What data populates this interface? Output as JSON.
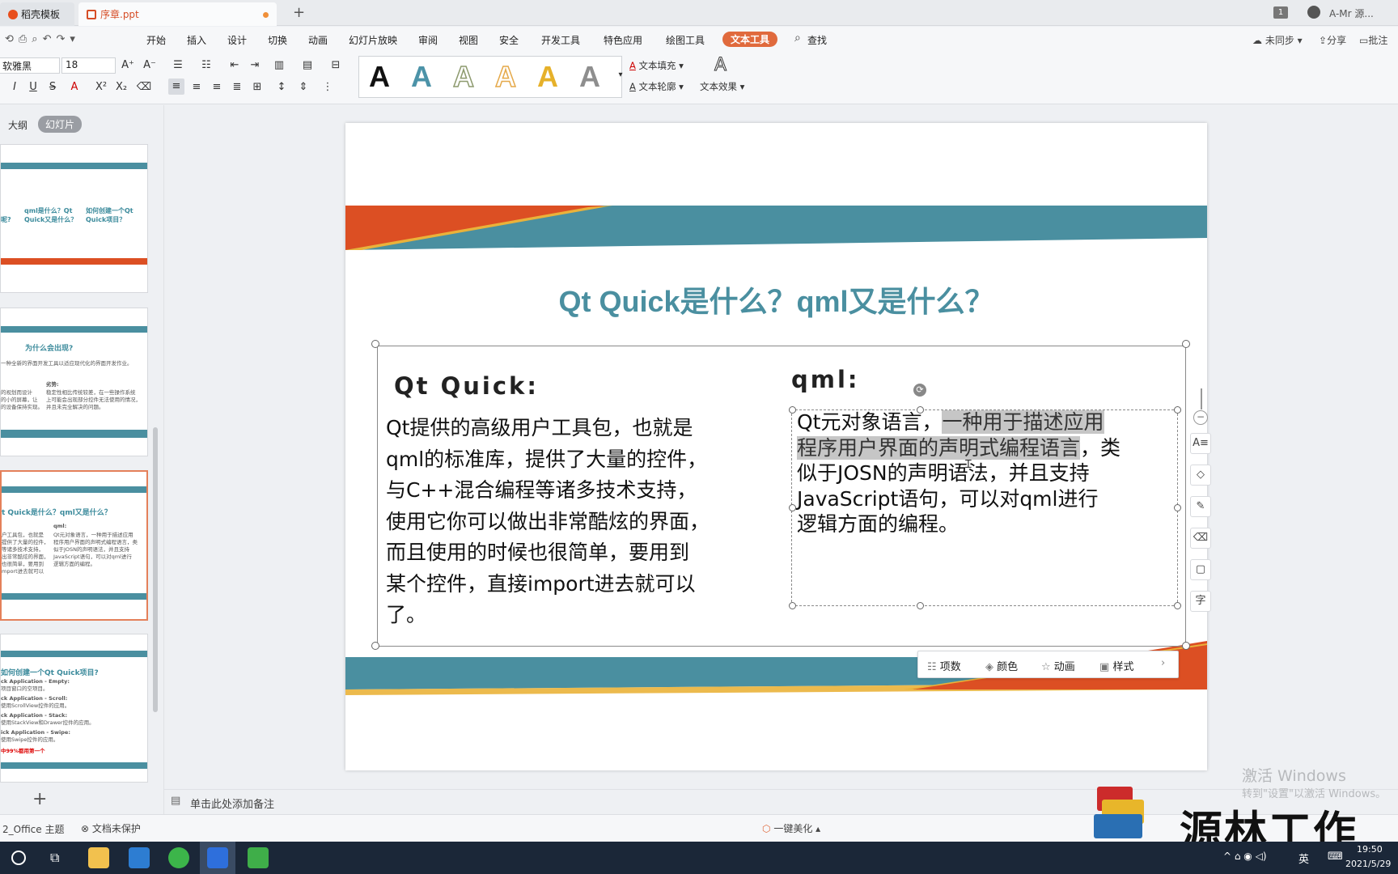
{
  "tabs": [
    {
      "label": "稻壳模板"
    },
    {
      "label": "序章.ppt"
    }
  ],
  "window_right": {
    "count": "1",
    "user": "A-Mr 源..."
  },
  "menu": [
    "开始",
    "插入",
    "设计",
    "切换",
    "动画",
    "幻灯片放映",
    "审阅",
    "视图",
    "安全",
    "开发工具",
    "特色应用",
    "绘图工具",
    "文本工具",
    "查找"
  ],
  "menu_right": {
    "sync": "未同步",
    "share": "分享",
    "comment": "批注"
  },
  "ribbon": {
    "font_name": "软雅黑",
    "font_size": "18",
    "text_fill": "文本填充",
    "text_outline": "文本轮廓",
    "text_effect": "文本效果",
    "gallery_letter": "A"
  },
  "left_pane": {
    "outline_tab": "大纲",
    "slides_tab": "幻灯片",
    "add_slide": "+"
  },
  "thumbs": {
    "t1": {
      "a": "qml是什么？Qt Quick又是什么？",
      "b": "如何创建一个Qt Quick项目？",
      "c": "呢?"
    },
    "t2": {
      "title": "为什么会出现?",
      "line": "一种全新的界面开发工具以适应现代化的界面开发作业。",
      "adv": "劣势:",
      "l1": "的视划而设计",
      "l2": "的小的屏幕，让",
      "l3": "的设备保持实现。",
      "r1": "稳定性相比传统较差，在一些操作系统",
      "r2": "上可能会出现部分控件无法使用的情况，",
      "r3": "并且未完全解决的问题。"
    },
    "t3": {
      "title": "t Quick是什么？qml又是什么？",
      "qml": "qml:",
      "l1": "户工具包，也就是",
      "l2": "提供了大量的控件，",
      "l3": "等诸多技术支持，",
      "l4": "出非常酷炫的界面，",
      "l5": "也很简单，要用到",
      "l6": "mport进去就可以",
      "r1": "Qt元对象语言，一种用于描述应用",
      "r2": "程序用户界面的声明式编程语言，类",
      "r3": "似于JOSN的声明语法，并且支持",
      "r4": "JavaScript语句，可以对qml进行",
      "r5": "逻辑方面的编程。"
    },
    "t4": {
      "title": "如何创建一个Qt Quick项目?",
      "a": "ck Application - Empty:",
      "a2": "项目窗口的空项目。",
      "b": "ck Application - Scroll:",
      "b2": "使用ScrollView控件的应用。",
      "c": "ck Application - Stack:",
      "c2": "使用StackView和Drawer控件的应用。",
      "d": "ick Application - Swipe:",
      "d2": "使用Swipe控件的应用。",
      "e": "中99%都用第一个"
    }
  },
  "slide": {
    "title": "Qt Quick是什么？qml又是什么？",
    "left_heading": "Qt Quick:",
    "left_lines": [
      "Qt提供的高级用户工具包，也就是",
      "qml的标准库，提供了大量的控件，",
      "与C++混合编程等诸多技术支持，",
      "使用它你可以做出非常酷炫的界面，",
      "而且使用的时候也很简单，要用到",
      "某个控件，直接import进去就可以",
      "了。"
    ],
    "right_heading": "qml:",
    "right_l1a": "Qt元对象语言，",
    "right_l1b": "一种用于描述应用",
    "right_l2a": "程序用户界面的声明式编程语言",
    "right_l2b": "，类",
    "right_l3": "似于JOSN的声明语法，并且支持",
    "right_l4": "JavaScript语句，可以对qml进行",
    "right_l5": "逻辑方面的编程。",
    "colors": {
      "teal": "#4a8fa0",
      "orange": "#dc4f23",
      "gold": "#eab23a"
    }
  },
  "float_toolbar": {
    "items": "项数",
    "color": "颜色",
    "anim": "动画",
    "style": "样式"
  },
  "note_placeholder": "单击此处添加备注",
  "statusbar": {
    "theme": "2_Office 主题",
    "protect": "文档未保护",
    "beautify": "一键美化"
  },
  "watermark": {
    "activate": "激活 Windows",
    "goto": "转到\"设置\"以激活 Windows。",
    "brand": "源林工作"
  },
  "tray": {
    "lang": "英",
    "time": "19:50",
    "date": "2021/5/29"
  }
}
